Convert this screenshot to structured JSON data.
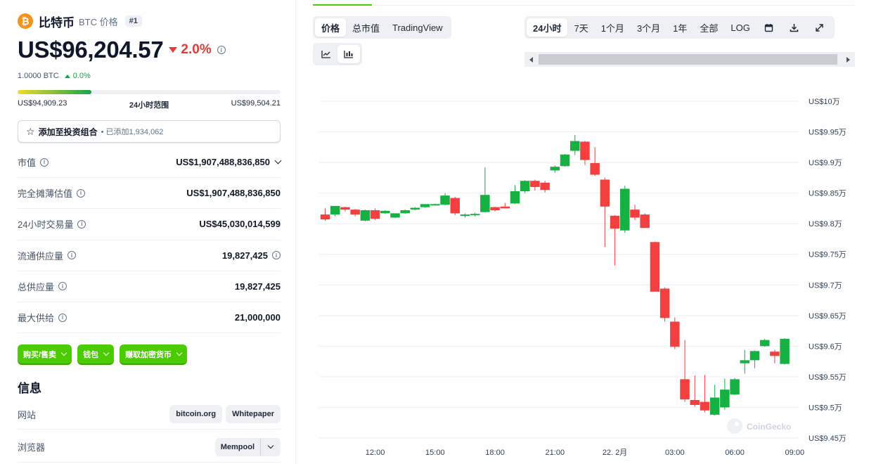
{
  "coin": {
    "name": "比特币",
    "symbol_label": "BTC 价格",
    "rank": "#1",
    "logo_glyph": "₿",
    "price": "US$96,204.57",
    "change_24h": "2.0%",
    "btc_price": "1.0000 BTC",
    "btc_change": "0.0%",
    "range_low": "US$94,909.23",
    "range_label": "24小时范围",
    "range_high": "US$99,504.21",
    "range_position": 0.28
  },
  "portfolio": {
    "label": "添加至投资组合",
    "added": "• 已添加1,934,062"
  },
  "stats": [
    {
      "label": "市值",
      "value": "US$1,907,488,836,850"
    },
    {
      "label": "完全摊薄估值",
      "value": "US$1,907,488,836,850"
    },
    {
      "label": "24小时交易量",
      "value": "US$45,030,014,599"
    },
    {
      "label": "流通供应量",
      "value": "19,827,425"
    },
    {
      "label": "总供应量",
      "value": "19,827,425"
    },
    {
      "label": "最大供给",
      "value": "21,000,000"
    }
  ],
  "actions": {
    "buy_sell": "购买/售卖",
    "wallet": "钱包",
    "earn": "赚取加密货币"
  },
  "info": {
    "title": "信息",
    "website_label": "网站",
    "website_link": "bitcoin.org",
    "whitepaper_link": "Whitepaper",
    "explorer_label": "浏览器",
    "explorer_link": "Mempool"
  },
  "chart_tabs": {
    "price": "价格",
    "market_cap": "总市值",
    "tradingview": "TradingView"
  },
  "time_tabs": [
    "24小时",
    "7天",
    "1个月",
    "3个月",
    "1年",
    "全部",
    "LOG"
  ],
  "watermark": "CoinGecko",
  "colors": {
    "up": "#16b143",
    "down": "#f23f3f",
    "accent": "#4bcc00"
  },
  "chart_data": {
    "type": "candlestick",
    "y_labels": [
      "US$10万",
      "US$9.95万",
      "US$9.9万",
      "US$9.85万",
      "US$9.8万",
      "US$9.75万",
      "US$9.7万",
      "US$9.65万",
      "US$9.6万",
      "US$9.55万",
      "US$9.5万",
      "US$9.45万"
    ],
    "y_ticks": [
      100000,
      99500,
      99000,
      98500,
      98000,
      97500,
      97000,
      96500,
      96000,
      95500,
      95000,
      94500
    ],
    "ylim": [
      94500,
      100000
    ],
    "x_labels": [
      "12:00",
      "15:00",
      "18:00",
      "21:00",
      "22. 2月",
      "03:00",
      "06:00",
      "09:00"
    ],
    "x_ticks": [
      12,
      15,
      18,
      21,
      24,
      27,
      30,
      33
    ],
    "xlim": [
      9.2,
      33.2
    ],
    "grid": true,
    "candles": [
      {
        "t": 9.5,
        "o": 98150,
        "h": 98250,
        "l": 98050,
        "c": 98070
      },
      {
        "t": 10.0,
        "o": 98150,
        "h": 98280,
        "l": 98120,
        "c": 98290
      },
      {
        "t": 10.5,
        "o": 98270,
        "h": 98280,
        "l": 98200,
        "c": 98230
      },
      {
        "t": 11.0,
        "o": 98230,
        "h": 98240,
        "l": 98120,
        "c": 98150
      },
      {
        "t": 11.5,
        "o": 98050,
        "h": 98230,
        "l": 98040,
        "c": 98220
      },
      {
        "t": 12.0,
        "o": 98220,
        "h": 98250,
        "l": 98060,
        "c": 98080
      },
      {
        "t": 12.5,
        "o": 98170,
        "h": 98220,
        "l": 98160,
        "c": 98210
      },
      {
        "t": 13.0,
        "o": 98100,
        "h": 98170,
        "l": 98090,
        "c": 98170
      },
      {
        "t": 13.5,
        "o": 98170,
        "h": 98230,
        "l": 98160,
        "c": 98220
      },
      {
        "t": 14.0,
        "o": 98230,
        "h": 98270,
        "l": 98220,
        "c": 98260
      },
      {
        "t": 14.5,
        "o": 98270,
        "h": 98310,
        "l": 98260,
        "c": 98320
      },
      {
        "t": 15.0,
        "o": 98310,
        "h": 98330,
        "l": 98300,
        "c": 98320
      },
      {
        "t": 15.5,
        "o": 98310,
        "h": 98500,
        "l": 98300,
        "c": 98460
      },
      {
        "t": 16.0,
        "o": 98420,
        "h": 98440,
        "l": 98140,
        "c": 98170
      },
      {
        "t": 16.5,
        "o": 98140,
        "h": 98170,
        "l": 98100,
        "c": 98150
      },
      {
        "t": 17.0,
        "o": 98150,
        "h": 98180,
        "l": 98120,
        "c": 98160
      },
      {
        "t": 17.5,
        "o": 98190,
        "h": 98920,
        "l": 98180,
        "c": 98470
      },
      {
        "t": 18.0,
        "o": 98270,
        "h": 98280,
        "l": 98200,
        "c": 98220
      },
      {
        "t": 18.5,
        "o": 98280,
        "h": 98340,
        "l": 98260,
        "c": 98250
      },
      {
        "t": 19.0,
        "o": 98330,
        "h": 98630,
        "l": 98320,
        "c": 98530
      },
      {
        "t": 19.5,
        "o": 98530,
        "h": 98710,
        "l": 98500,
        "c": 98700
      },
      {
        "t": 20.0,
        "o": 98700,
        "h": 98720,
        "l": 98540,
        "c": 98600
      },
      {
        "t": 20.5,
        "o": 98670,
        "h": 98700,
        "l": 98510,
        "c": 98550
      },
      {
        "t": 21.0,
        "o": 98870,
        "h": 98950,
        "l": 98830,
        "c": 98930
      },
      {
        "t": 21.5,
        "o": 98940,
        "h": 99140,
        "l": 98930,
        "c": 99130
      },
      {
        "t": 22.0,
        "o": 99190,
        "h": 99450,
        "l": 99120,
        "c": 99350
      },
      {
        "t": 22.5,
        "o": 99340,
        "h": 99350,
        "l": 98960,
        "c": 99040
      },
      {
        "t": 23.0,
        "o": 98990,
        "h": 99250,
        "l": 98780,
        "c": 98800
      },
      {
        "t": 23.5,
        "o": 98720,
        "h": 98750,
        "l": 97620,
        "c": 98280
      },
      {
        "t": 24.0,
        "o": 98130,
        "h": 98140,
        "l": 97320,
        "c": 97920
      },
      {
        "t": 24.5,
        "o": 97890,
        "h": 98620,
        "l": 97850,
        "c": 98570
      },
      {
        "t": 25.0,
        "o": 98230,
        "h": 98310,
        "l": 98060,
        "c": 98100
      },
      {
        "t": 25.5,
        "o": 98150,
        "h": 98170,
        "l": 97950,
        "c": 97930
      },
      {
        "t": 26.0,
        "o": 97700,
        "h": 97710,
        "l": 96950,
        "c": 96890
      },
      {
        "t": 26.5,
        "o": 96940,
        "h": 96960,
        "l": 96400,
        "c": 96460
      },
      {
        "t": 27.0,
        "o": 96400,
        "h": 96470,
        "l": 95950,
        "c": 95990
      },
      {
        "t": 27.5,
        "o": 95460,
        "h": 96100,
        "l": 95090,
        "c": 95130
      },
      {
        "t": 28.0,
        "o": 95120,
        "h": 95520,
        "l": 95010,
        "c": 95040
      },
      {
        "t": 28.5,
        "o": 95090,
        "h": 95530,
        "l": 94920,
        "c": 94950
      },
      {
        "t": 29.0,
        "o": 94880,
        "h": 95370,
        "l": 94870,
        "c": 95160
      },
      {
        "t": 29.5,
        "o": 95000,
        "h": 95470,
        "l": 94960,
        "c": 95290
      },
      {
        "t": 30.0,
        "o": 95210,
        "h": 95480,
        "l": 95200,
        "c": 95460
      },
      {
        "t": 30.5,
        "o": 95720,
        "h": 95940,
        "l": 95550,
        "c": 95770
      },
      {
        "t": 31.0,
        "o": 95770,
        "h": 95930,
        "l": 95640,
        "c": 95920
      },
      {
        "t": 31.5,
        "o": 96000,
        "h": 96120,
        "l": 95990,
        "c": 96100
      },
      {
        "t": 32.0,
        "o": 95910,
        "h": 95940,
        "l": 95720,
        "c": 95840
      },
      {
        "t": 32.5,
        "o": 95710,
        "h": 96130,
        "l": 95700,
        "c": 96120
      }
    ]
  }
}
